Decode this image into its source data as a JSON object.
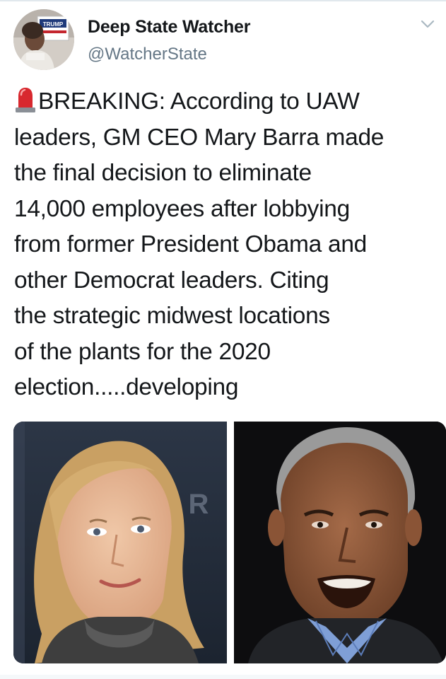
{
  "tweet": {
    "author": {
      "display_name": "Deep State Watcher",
      "handle": "@WatcherState",
      "avatar_sign_text": "TRUMP",
      "avatar_icon": "profile-photo"
    },
    "menu_icon": "chevron-down-icon",
    "body": {
      "prefix_icon": "rotating-light-emoji",
      "lines": [
        "BREAKING: According to UAW",
        "leaders, GM CEO Mary Barra made",
        "the final decision to eliminate",
        "14,000 employees after lobbying",
        "from former President Obama and",
        "other Democrat leaders. Citing",
        "the strategic midwest locations",
        "of the plants for the 2020",
        "election.....developing"
      ]
    },
    "media": {
      "photos": [
        {
          "name": "photo-mary-barra",
          "backdrop_letter": "R"
        },
        {
          "name": "photo-barack-obama"
        }
      ]
    }
  },
  "colors": {
    "text": "#14171a",
    "secondary": "#657786",
    "divider": "#e1e8ed",
    "siren_red": "#d8282e"
  }
}
